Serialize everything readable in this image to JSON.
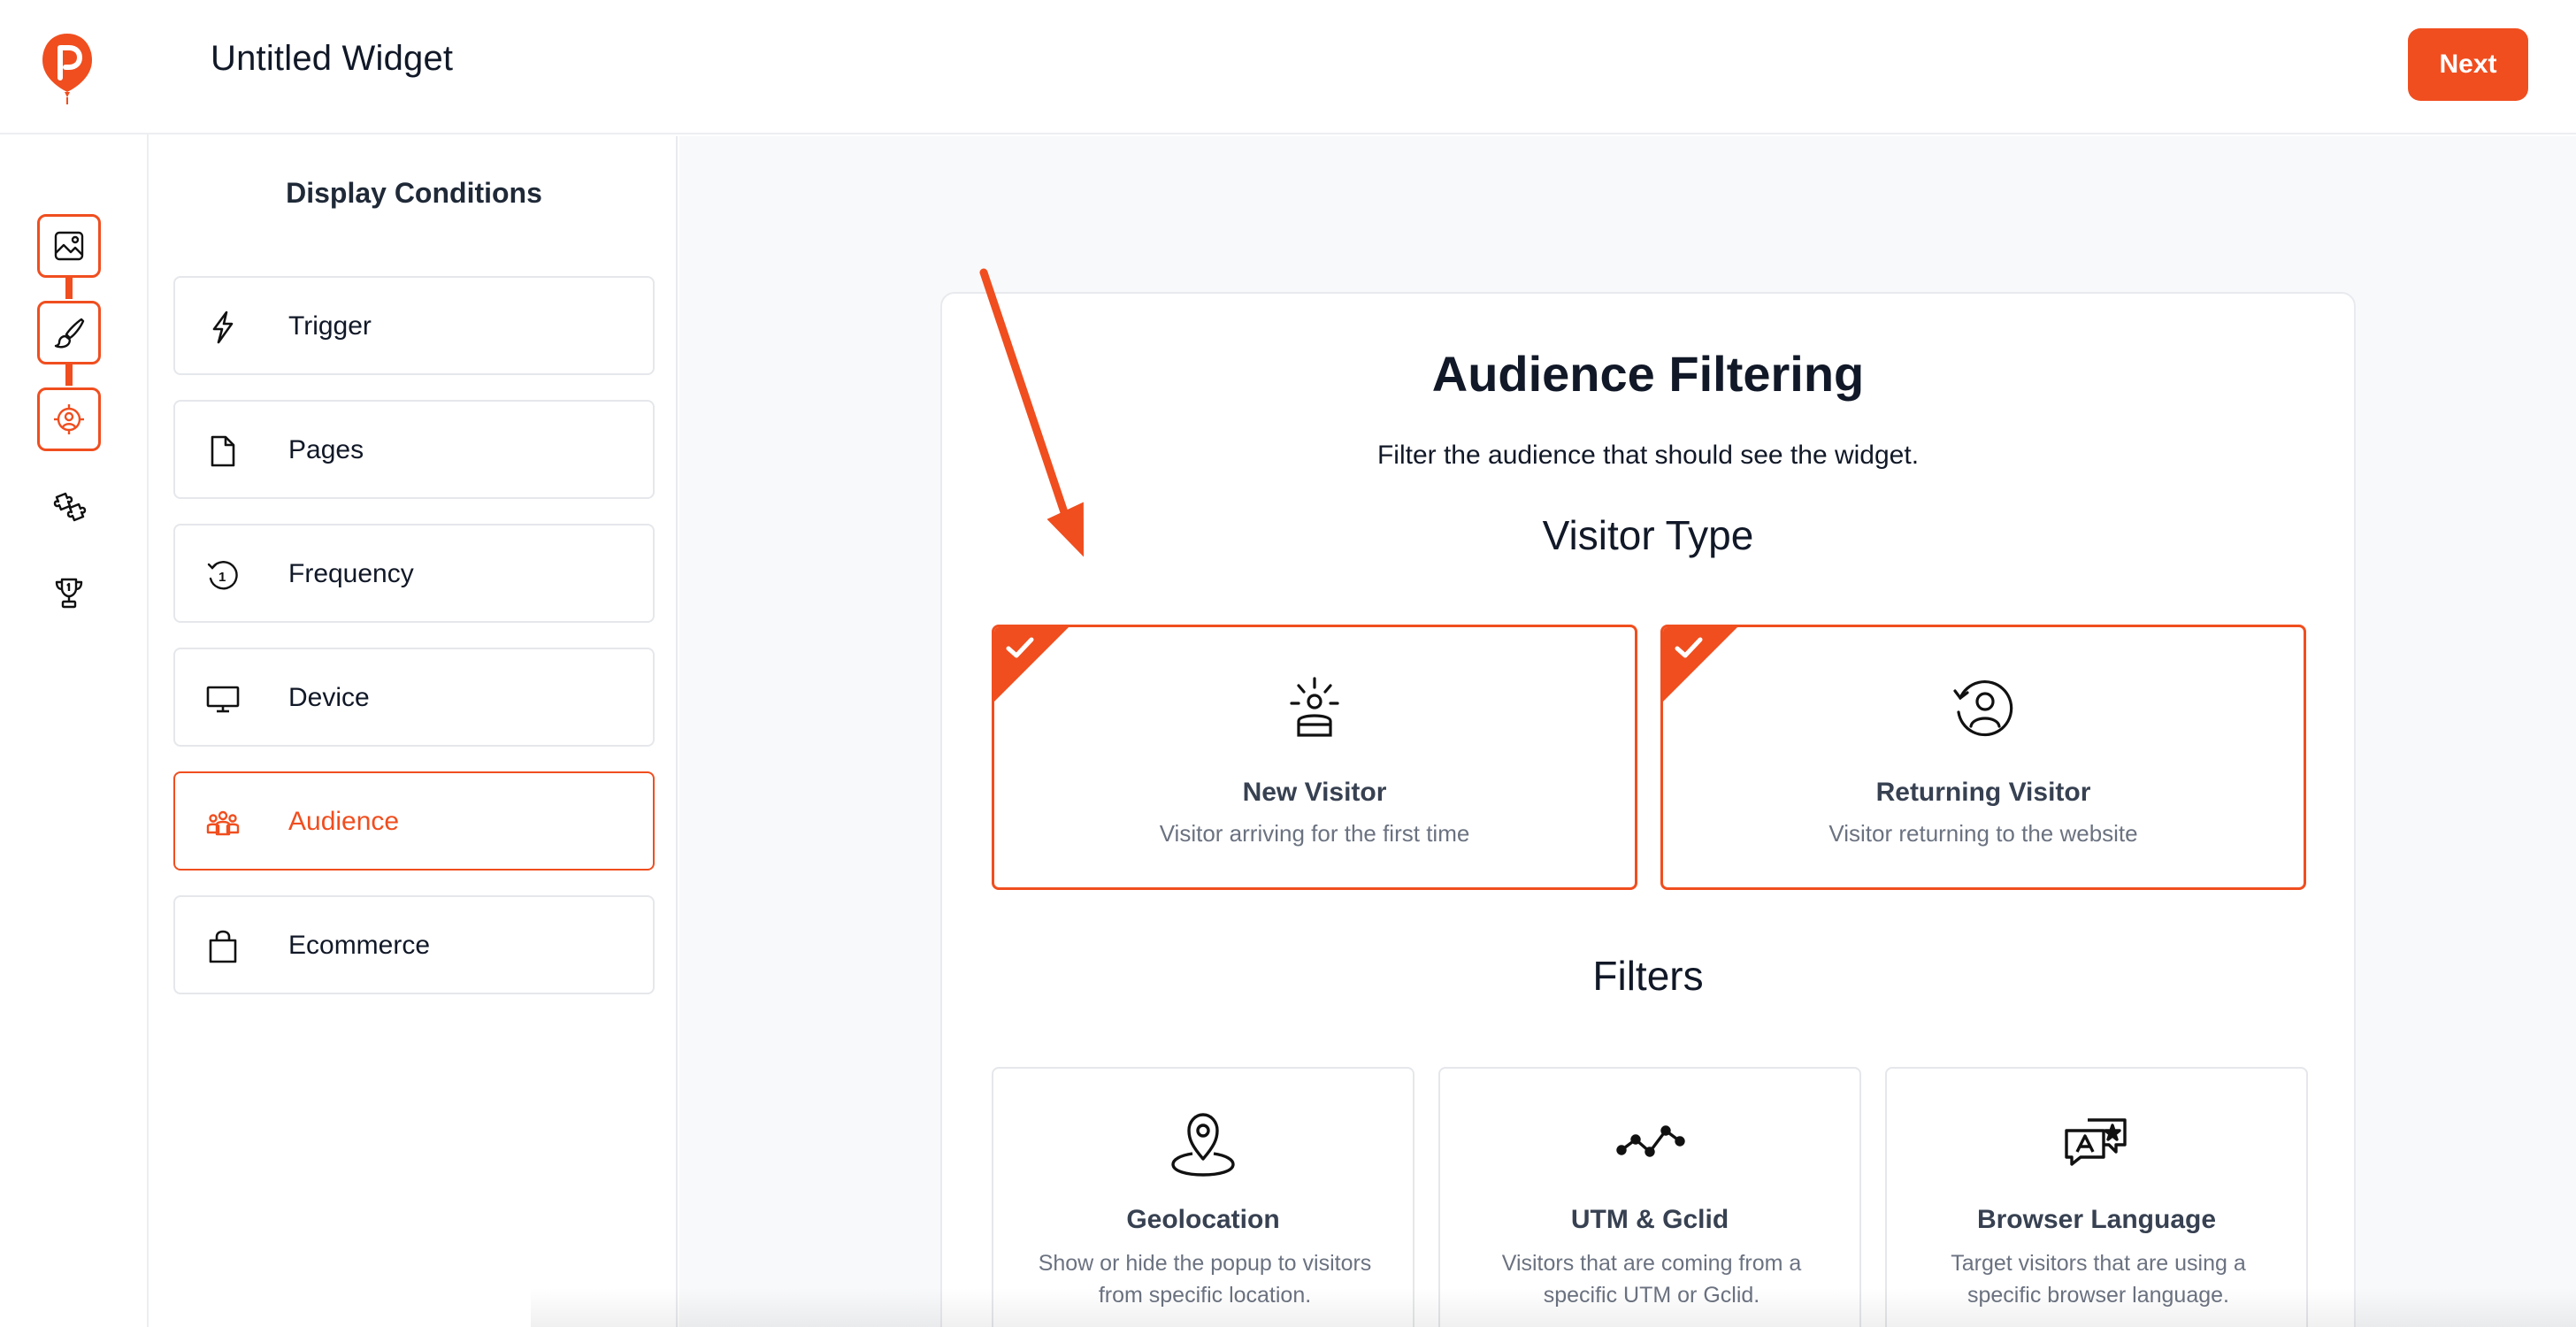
{
  "header": {
    "title": "Untitled Widget",
    "next_label": "Next",
    "logo_icon": "balloon-p-logo",
    "accent_color": "#f04e1f"
  },
  "rail": {
    "items": [
      {
        "icon": "image-icon",
        "active": true
      },
      {
        "icon": "brush-icon",
        "active": true
      },
      {
        "icon": "target-icon",
        "active": true
      },
      {
        "icon": "puzzle-icon",
        "active": false
      },
      {
        "icon": "trophy-icon",
        "active": false
      }
    ]
  },
  "sidebar": {
    "title": "Display Conditions",
    "items": [
      {
        "label": "Trigger",
        "icon": "lightning-icon"
      },
      {
        "label": "Pages",
        "icon": "page-icon"
      },
      {
        "label": "Frequency",
        "icon": "clock-history-icon"
      },
      {
        "label": "Device",
        "icon": "monitor-icon"
      },
      {
        "label": "Audience",
        "icon": "people-group-icon",
        "active": true
      },
      {
        "label": "Ecommerce",
        "icon": "shopping-bag-icon"
      }
    ]
  },
  "main": {
    "title": "Audience Filtering",
    "subtitle": "Filter the audience that should see the widget.",
    "visitor_type_heading": "Visitor Type",
    "visitor_options": [
      {
        "title": "New Visitor",
        "description": "Visitor arriving for the first time",
        "icon": "new-visitor-icon",
        "selected": true
      },
      {
        "title": "Returning Visitor",
        "description": "Visitor returning to the website",
        "icon": "returning-visitor-icon",
        "selected": true
      }
    ],
    "filters_heading": "Filters",
    "filters": [
      {
        "title": "Geolocation",
        "description": "Show or hide the popup to visitors from specific location.",
        "icon": "map-pin-icon"
      },
      {
        "title": "UTM & Gclid",
        "description": "Visitors that are coming from a specific UTM or Gclid.",
        "icon": "trend-line-icon"
      },
      {
        "title": "Browser Language",
        "description": "Target visitors that are using a specific browser language.",
        "icon": "language-chat-icon"
      }
    ]
  }
}
